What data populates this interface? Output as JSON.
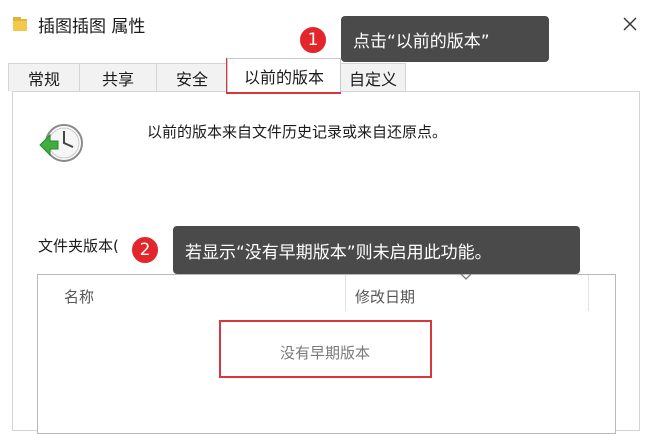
{
  "window": {
    "title": "插图插图 属性",
    "folder_icon": "folder-icon",
    "close_icon": "close-icon"
  },
  "tabs": [
    {
      "label": "常规"
    },
    {
      "label": "共享"
    },
    {
      "label": "安全"
    },
    {
      "label": "以前的版本",
      "active": true
    },
    {
      "label": "自定义"
    }
  ],
  "previous_versions": {
    "icon": "restore-clock-icon",
    "description": "以前的版本来自文件历史记录或来自还原点。",
    "folder_versions_label": "文件夹版本(",
    "columns": {
      "name": "名称",
      "date_modified": "修改日期"
    },
    "empty_message": "没有早期版本"
  },
  "annotations": [
    {
      "number": "1",
      "text": "点击“以前的版本”"
    },
    {
      "number": "2",
      "text": "若显示“没有早期版本”则未启用此功能。"
    }
  ],
  "colors": {
    "highlight": "#d9363e",
    "badge": "#e3262b",
    "tooltip_bg": "#4a4a4a"
  }
}
